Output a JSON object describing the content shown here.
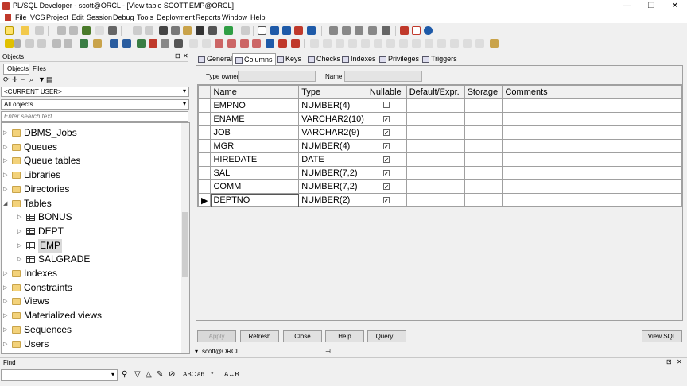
{
  "window": {
    "title": "PL/SQL Developer - scott@ORCL - [View table SCOTT.EMP@ORCL]",
    "minimize": "—",
    "restore": "❐",
    "close": "✕"
  },
  "menu": [
    "File",
    "VCS",
    "Project",
    "Edit",
    "Session",
    "Debug",
    "Tools",
    "Reports",
    "Deployment",
    "Reports",
    "Window",
    "Help"
  ],
  "objects_panel": {
    "header": "Objects",
    "pin": "⊡",
    "close": "✕",
    "tabs": [
      "Objects",
      "Files"
    ],
    "user_combo": "<CURRENT USER>",
    "filter_combo": "All objects",
    "search_placeholder": "Enter search text...",
    "tree": [
      {
        "label": "DBMS_Jobs",
        "level": 0,
        "type": "folder",
        "expander": "▷"
      },
      {
        "label": "Queues",
        "level": 0,
        "type": "folder",
        "expander": "▷"
      },
      {
        "label": "Queue tables",
        "level": 0,
        "type": "folder",
        "expander": "▷"
      },
      {
        "label": "Libraries",
        "level": 0,
        "type": "folder",
        "expander": "▷"
      },
      {
        "label": "Directories",
        "level": 0,
        "type": "folder",
        "expander": "▷"
      },
      {
        "label": "Tables",
        "level": 0,
        "type": "folder",
        "expander": "◢"
      },
      {
        "label": "BONUS",
        "level": 1,
        "type": "table",
        "expander": "▷"
      },
      {
        "label": "DEPT",
        "level": 1,
        "type": "table",
        "expander": "▷"
      },
      {
        "label": "EMP",
        "level": 1,
        "type": "table",
        "expander": "▷",
        "selected": true
      },
      {
        "label": "SALGRADE",
        "level": 1,
        "type": "table",
        "expander": "▷"
      },
      {
        "label": "Indexes",
        "level": 0,
        "type": "folder",
        "expander": "▷"
      },
      {
        "label": "Constraints",
        "level": 0,
        "type": "folder",
        "expander": "▷"
      },
      {
        "label": "Views",
        "level": 0,
        "type": "folder",
        "expander": "▷"
      },
      {
        "label": "Materialized views",
        "level": 0,
        "type": "folder",
        "expander": "▷"
      },
      {
        "label": "Sequences",
        "level": 0,
        "type": "folder",
        "expander": "▷"
      },
      {
        "label": "Users",
        "level": 0,
        "type": "folder",
        "expander": "▷"
      }
    ]
  },
  "table_view": {
    "tabs": [
      "General",
      "Columns",
      "Keys",
      "Checks",
      "Indexes",
      "Privileges",
      "Triggers"
    ],
    "active_tab": "Columns",
    "type_owner_label": "Type owner",
    "name_label": "Name",
    "headers": [
      "Name",
      "Type",
      "Nullable",
      "Default/Expr.",
      "Storage",
      "Comments"
    ],
    "rows": [
      {
        "name": "EMPNO",
        "type": "NUMBER(4)",
        "nullable": false
      },
      {
        "name": "ENAME",
        "type": "VARCHAR2(10)",
        "nullable": true
      },
      {
        "name": "JOB",
        "type": "VARCHAR2(9)",
        "nullable": true
      },
      {
        "name": "MGR",
        "type": "NUMBER(4)",
        "nullable": true
      },
      {
        "name": "HIREDATE",
        "type": "DATE",
        "nullable": true
      },
      {
        "name": "SAL",
        "type": "NUMBER(7,2)",
        "nullable": true
      },
      {
        "name": "COMM",
        "type": "NUMBER(7,2)",
        "nullable": true
      },
      {
        "name": "DEPTNO",
        "type": "NUMBER(2)",
        "nullable": true,
        "current": true
      }
    ],
    "check_mark": "✓",
    "row_pointer": "▶",
    "buttons": {
      "apply": "Apply",
      "refresh": "Refresh",
      "close": "Close",
      "help": "Help",
      "query": "Query...",
      "view_sql": "View SQL"
    },
    "connection": "scott@ORCL",
    "connection_arrow": "▾"
  },
  "find_bar": {
    "label": "Find",
    "pin": "⊡",
    "close": "✕"
  }
}
